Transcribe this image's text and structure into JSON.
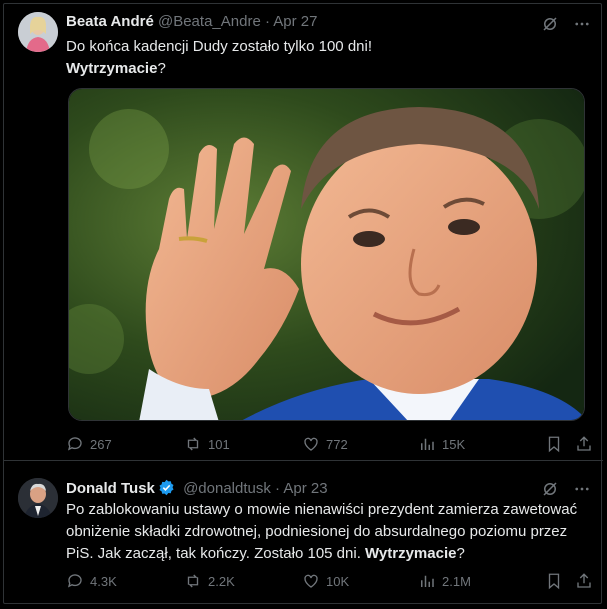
{
  "tweets": [
    {
      "author_name": "Beata André",
      "author_handle": "@Beata_Andre",
      "separator": "·",
      "date": "Apr 27",
      "text_line1": "Do końca kadencji Dudy zostało tylko 100 dni!",
      "text_bold": "Wytrzymacie",
      "text_end": "?",
      "stats": {
        "replies": "267",
        "reposts": "101",
        "likes": "772",
        "views": "15K"
      }
    },
    {
      "author_name": "Donald Tusk",
      "author_handle": "@donaldtusk",
      "separator": "·",
      "date": "Apr 23",
      "verified": true,
      "text_main": "Po zablokowaniu ustawy o mowie nienawiści prezydent zamierza zawetować obniżenie składki zdrowotnej, podniesionej do absurdalnego poziomu przez PiS. Jak zaczął, tak kończy. Zostało 105 dni. ",
      "text_bold": "Wytrzymacie",
      "text_end": "?",
      "stats": {
        "replies": "4.3K",
        "reposts": "2.2K",
        "likes": "10K",
        "views": "2.1M"
      }
    }
  ],
  "colors": {
    "background": "#000000",
    "text": "#e7e9ea",
    "muted": "#71767b",
    "border": "#2f3336",
    "verified": "#1d9bf0"
  }
}
